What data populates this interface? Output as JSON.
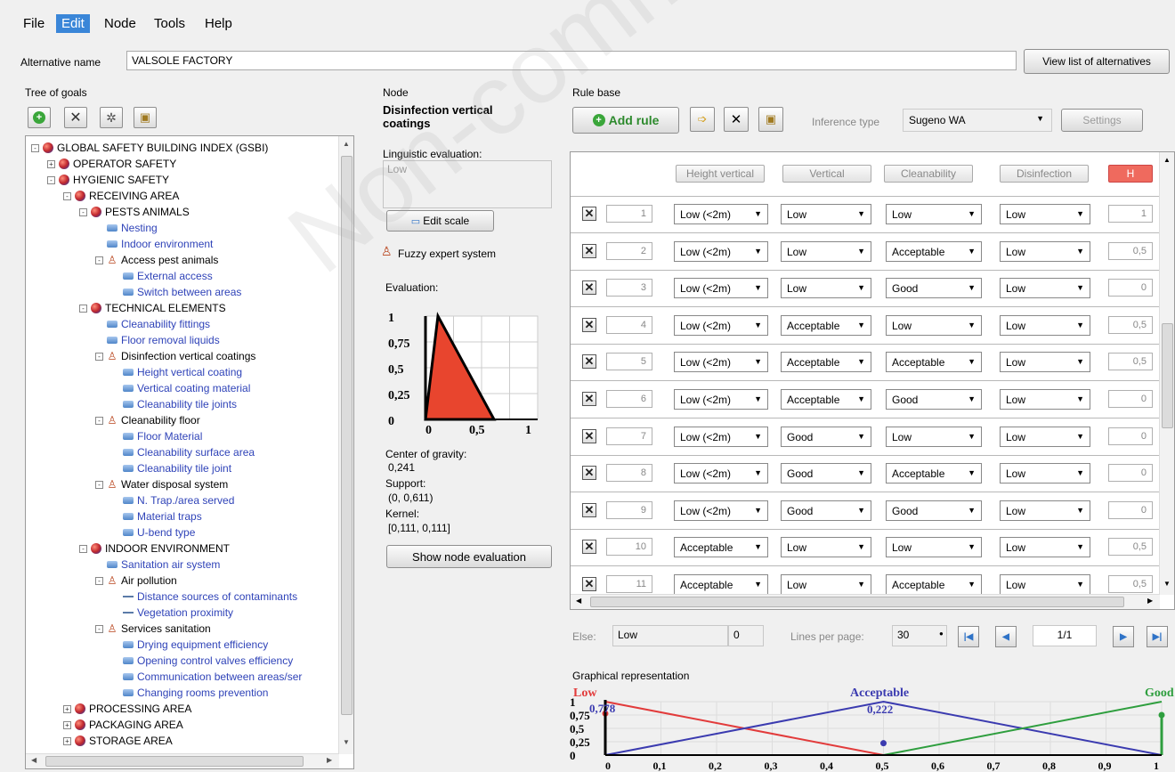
{
  "menu": {
    "items": [
      "File",
      "Edit",
      "Node",
      "Tools",
      "Help"
    ],
    "active": "Edit"
  },
  "alternative": {
    "label": "Alternative name",
    "value": "VALSOLE FACTORY",
    "view_list_label": "View list of alternatives"
  },
  "tree": {
    "title": "Tree of goals",
    "toolbar_icons": [
      "add-icon",
      "delete-icon",
      "tree-icon",
      "export-icon"
    ],
    "rows": [
      {
        "text": "GLOBAL SAFETY BUILDING INDEX (GSBI)",
        "level": 0,
        "icon": "ball",
        "exp": "-"
      },
      {
        "text": "OPERATOR SAFETY",
        "level": 1,
        "icon": "ball",
        "exp": "+"
      },
      {
        "text": "HYGIENIC SAFETY",
        "level": 1,
        "icon": "ball",
        "exp": "-"
      },
      {
        "text": "RECEIVING AREA",
        "level": 2,
        "icon": "ball",
        "exp": "-"
      },
      {
        "text": "PESTS ANIMALS",
        "level": 3,
        "icon": "ball",
        "exp": "-"
      },
      {
        "text": "Nesting",
        "level": 4,
        "icon": "leaf",
        "exp": ""
      },
      {
        "text": "Indoor environment",
        "level": 4,
        "icon": "leaf",
        "exp": ""
      },
      {
        "text": "Access pest animals",
        "level": 4,
        "icon": "person",
        "exp": "-"
      },
      {
        "text": "External access",
        "level": 5,
        "icon": "leaf",
        "exp": ""
      },
      {
        "text": "Switch between areas",
        "level": 5,
        "icon": "leaf",
        "exp": ""
      },
      {
        "text": "TECHNICAL ELEMENTS",
        "level": 3,
        "icon": "ball",
        "exp": "-"
      },
      {
        "text": "Cleanability fittings",
        "level": 4,
        "icon": "leaf",
        "exp": ""
      },
      {
        "text": "Floor removal liquids",
        "level": 4,
        "icon": "leaf",
        "exp": ""
      },
      {
        "text": "Disinfection vertical coatings",
        "level": 4,
        "icon": "person",
        "exp": "-"
      },
      {
        "text": "Height vertical coating",
        "level": 5,
        "icon": "leaf",
        "exp": ""
      },
      {
        "text": "Vertical coating material",
        "level": 5,
        "icon": "leaf",
        "exp": ""
      },
      {
        "text": "Cleanability tile joints",
        "level": 5,
        "icon": "leaf",
        "exp": ""
      },
      {
        "text": "Cleanability floor",
        "level": 4,
        "icon": "person",
        "exp": "-"
      },
      {
        "text": "Floor Material",
        "level": 5,
        "icon": "leaf",
        "exp": ""
      },
      {
        "text": "Cleanability surface area",
        "level": 5,
        "icon": "leaf",
        "exp": ""
      },
      {
        "text": "Cleanability tile joint",
        "level": 5,
        "icon": "leaf",
        "exp": ""
      },
      {
        "text": "Water disposal system",
        "level": 4,
        "icon": "person",
        "exp": "-"
      },
      {
        "text": "N. Trap./area served",
        "level": 5,
        "icon": "leaf",
        "exp": ""
      },
      {
        "text": "Material traps",
        "level": 5,
        "icon": "leaf",
        "exp": ""
      },
      {
        "text": "U-bend type",
        "level": 5,
        "icon": "leaf",
        "exp": ""
      },
      {
        "text": "INDOOR ENVIRONMENT",
        "level": 3,
        "icon": "ball",
        "exp": "-"
      },
      {
        "text": "Sanitation air system",
        "level": 4,
        "icon": "leaf",
        "exp": ""
      },
      {
        "text": "Air pollution",
        "level": 4,
        "icon": "person",
        "exp": "-"
      },
      {
        "text": "Distance sources of contaminants",
        "level": 5,
        "icon": "dash",
        "exp": ""
      },
      {
        "text": "Vegetation proximity",
        "level": 5,
        "icon": "dash",
        "exp": ""
      },
      {
        "text": "Services sanitation",
        "level": 4,
        "icon": "person",
        "exp": "-"
      },
      {
        "text": "Drying equipment efficiency",
        "level": 5,
        "icon": "leaf",
        "exp": ""
      },
      {
        "text": "Opening control valves efficiency",
        "level": 5,
        "icon": "leaf",
        "exp": ""
      },
      {
        "text": "Communication between areas/ser",
        "level": 5,
        "icon": "leaf",
        "exp": ""
      },
      {
        "text": "Changing rooms prevention",
        "level": 5,
        "icon": "leaf",
        "exp": ""
      },
      {
        "text": "PROCESSING AREA",
        "level": 2,
        "icon": "ball",
        "exp": "+"
      },
      {
        "text": "PACKAGING AREA",
        "level": 2,
        "icon": "ball",
        "exp": "+"
      },
      {
        "text": "STORAGE AREA",
        "level": 2,
        "icon": "ball",
        "exp": "+"
      }
    ]
  },
  "node": {
    "title": "Node",
    "name": "Disinfection vertical coatings",
    "ling_label": "Linguistic evaluation:",
    "ling_value": "Low",
    "edit_scale": "Edit scale",
    "fuzzy_label": "Fuzzy expert system",
    "evaluation_label": "Evaluation:",
    "chart_y_ticks": [
      "1",
      "0,75",
      "0,5",
      "0,25",
      "0"
    ],
    "chart_x_ticks": [
      "0",
      "0,5",
      "1"
    ],
    "cog_label": "Center of gravity:",
    "cog_value": "0,241",
    "support_label": "Support:",
    "support_value": "(0, 0,611)",
    "kernel_label": "Kernel:",
    "kernel_value": "[0,111, 0,111]",
    "show_button": "Show node evaluation",
    "eval_shape": {
      "support": [
        0,
        0.611
      ],
      "kernel": 0.111
    }
  },
  "rules": {
    "title": "Rule base",
    "add_rule": "Add rule",
    "inference_label": "Inference type",
    "inference_value": "Sugeno WA",
    "settings_label": "Settings",
    "headers": [
      "Height vertical",
      "Vertical",
      "Cleanability",
      "Disinfection",
      "H"
    ],
    "rows": [
      {
        "n": "1",
        "a": "Low (<2m)",
        "b": "Low",
        "c": "Low",
        "d": "Low",
        "h": "1"
      },
      {
        "n": "2",
        "a": "Low (<2m)",
        "b": "Low",
        "c": "Acceptable",
        "d": "Low",
        "h": "0,5"
      },
      {
        "n": "3",
        "a": "Low (<2m)",
        "b": "Low",
        "c": "Good",
        "d": "Low",
        "h": "0"
      },
      {
        "n": "4",
        "a": "Low (<2m)",
        "b": "Acceptable",
        "c": "Low",
        "d": "Low",
        "h": "0,5"
      },
      {
        "n": "5",
        "a": "Low (<2m)",
        "b": "Acceptable",
        "c": "Acceptable",
        "d": "Low",
        "h": "0,5"
      },
      {
        "n": "6",
        "a": "Low (<2m)",
        "b": "Acceptable",
        "c": "Good",
        "d": "Low",
        "h": "0"
      },
      {
        "n": "7",
        "a": "Low (<2m)",
        "b": "Good",
        "c": "Low",
        "d": "Low",
        "h": "0"
      },
      {
        "n": "8",
        "a": "Low (<2m)",
        "b": "Good",
        "c": "Acceptable",
        "d": "Low",
        "h": "0"
      },
      {
        "n": "9",
        "a": "Low (<2m)",
        "b": "Good",
        "c": "Good",
        "d": "Low",
        "h": "0"
      },
      {
        "n": "10",
        "a": "Acceptable",
        "b": "Low",
        "c": "Low",
        "d": "Low",
        "h": "0,5"
      },
      {
        "n": "11",
        "a": "Acceptable",
        "b": "Low",
        "c": "Acceptable",
        "d": "Low",
        "h": "0,5"
      }
    ],
    "else_label": "Else:",
    "else_value": "Low",
    "else_num": "0",
    "lines_label": "Lines per page:",
    "lines_value": "30",
    "page_value": "1/1"
  },
  "graph": {
    "title": "Graphical representation",
    "labels": [
      "Low",
      "Acceptable",
      "Good"
    ],
    "values": [
      "0,778",
      "0,222"
    ],
    "y_ticks": [
      "1",
      "0,75",
      "0,5",
      "0,25",
      "0"
    ],
    "x_ticks": [
      "0",
      "0,1",
      "0,2",
      "0,3",
      "0,4",
      "0,5",
      "0,6",
      "0,7",
      "0,8",
      "0,9",
      "1"
    ],
    "colors": {
      "low": "#e23b3b",
      "acceptable": "#3b3bb0",
      "good": "#2e9e3e"
    },
    "markers": [
      {
        "set": "low",
        "x": 0,
        "y": 0.778
      },
      {
        "set": "acceptable",
        "x": 0.5,
        "y": 0.222
      },
      {
        "set": "good",
        "x": 1,
        "y": 0.75
      }
    ]
  },
  "watermark": "Non-commercial"
}
